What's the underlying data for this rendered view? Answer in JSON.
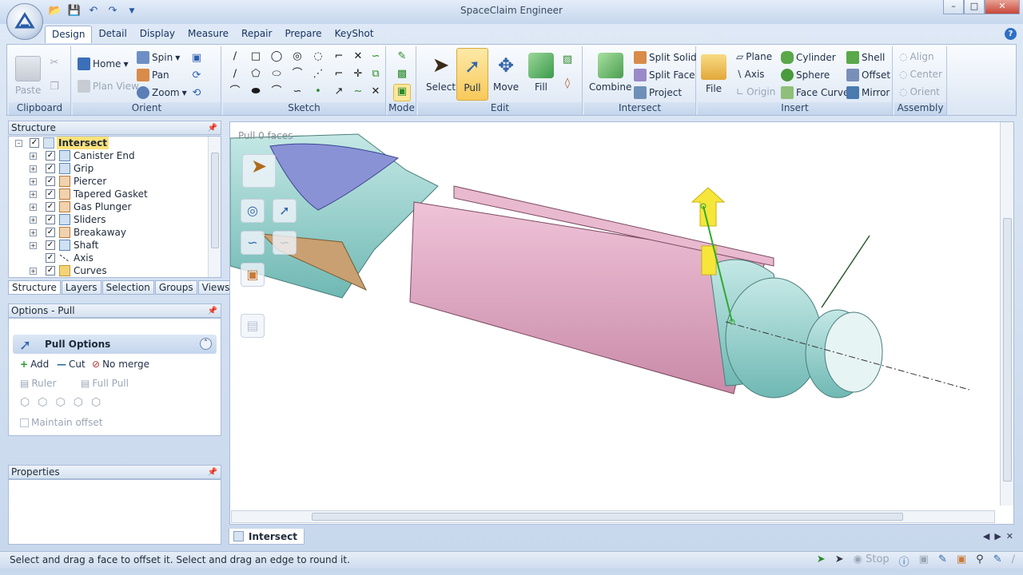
{
  "app": {
    "title": "SpaceClaim Engineer"
  },
  "ribbon_tabs": [
    "Design",
    "Detail",
    "Display",
    "Measure",
    "Repair",
    "Prepare",
    "KeyShot"
  ],
  "clipboard": {
    "paste": "Paste",
    "label": "Clipboard"
  },
  "orient": {
    "home": "Home",
    "plan_view": "Plan View",
    "spin": "Spin",
    "pan": "Pan",
    "zoom": "Zoom",
    "label": "Orient"
  },
  "sketch": {
    "label": "Sketch"
  },
  "mode": {
    "label": "Mode"
  },
  "edit": {
    "select": "Select",
    "pull": "Pull",
    "move": "Move",
    "fill": "Fill",
    "label": "Edit"
  },
  "intersect": {
    "combine": "Combine",
    "split_solid": "Split Solid",
    "split_face": "Split Face",
    "project": "Project",
    "label": "Intersect"
  },
  "insert": {
    "file": "File",
    "plane": "Plane",
    "axis": "Axis",
    "origin": "Origin",
    "cylinder": "Cylinder",
    "sphere": "Sphere",
    "face_curve": "Face Curve",
    "shell": "Shell",
    "offset": "Offset",
    "mirror": "Mirror",
    "label": "Insert"
  },
  "assembly": {
    "align": "Align",
    "center": "Center",
    "orient": "Orient",
    "label": "Assembly"
  },
  "structure": {
    "title": "Structure",
    "root": "Intersect",
    "items": [
      {
        "label": "Canister End",
        "icon": "solid-blue"
      },
      {
        "label": "Grip",
        "icon": "solid-blue"
      },
      {
        "label": "Piercer",
        "icon": "solid-orange"
      },
      {
        "label": "Tapered Gasket",
        "icon": "solid-orange"
      },
      {
        "label": "Gas Plunger",
        "icon": "solid-orange"
      },
      {
        "label": "Sliders",
        "icon": "solid-blue"
      },
      {
        "label": "Breakaway",
        "icon": "solid-orange"
      },
      {
        "label": "Shaft",
        "icon": "solid-blue"
      },
      {
        "label": "Axis",
        "icon": "axis"
      },
      {
        "label": "Curves",
        "icon": "folder"
      }
    ],
    "tabs": [
      "Structure",
      "Layers",
      "Selection",
      "Groups",
      "Views"
    ]
  },
  "options": {
    "title": "Options - Pull",
    "header": "Pull Options",
    "add": "Add",
    "cut": "Cut",
    "no_merge": "No merge",
    "ruler": "Ruler",
    "full_pull": "Full Pull",
    "maintain_offset": "Maintain offset"
  },
  "properties": {
    "title": "Properties"
  },
  "viewport": {
    "status": "Pull 0 faces"
  },
  "document_tab": "Intersect",
  "status_bar": {
    "message": "Select and drag a face to offset it. Select and drag an edge to round it.",
    "stop": "Stop"
  }
}
